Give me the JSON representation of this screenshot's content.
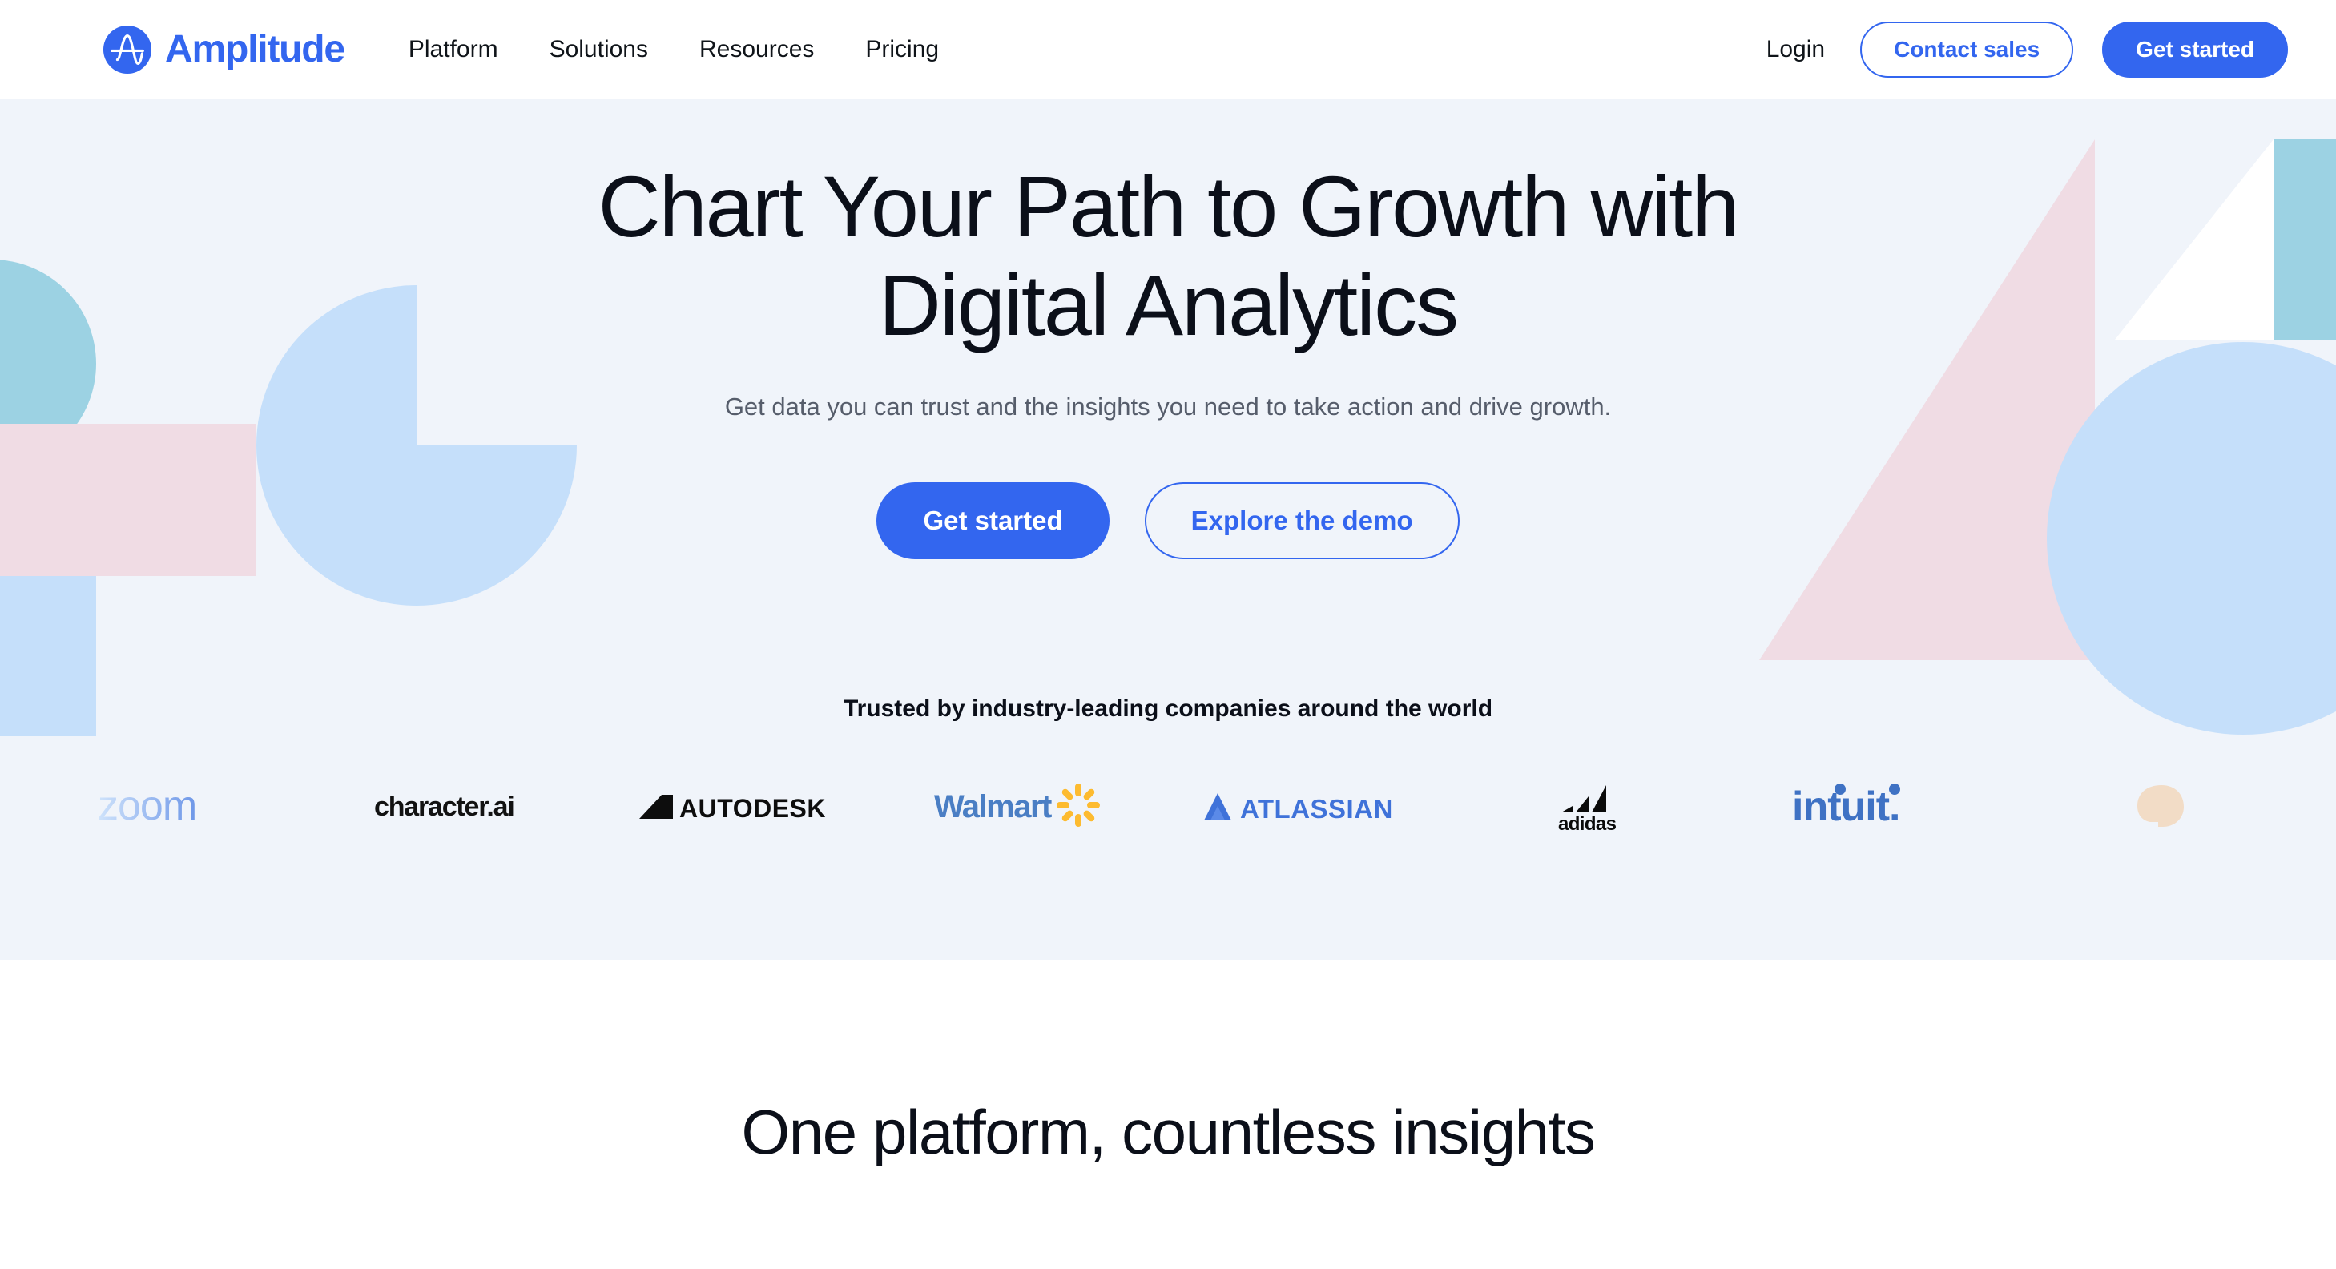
{
  "brand": {
    "name": "Amplitude",
    "logo_icon": "amplitude-wave-icon",
    "color": "#3366ef"
  },
  "nav": {
    "items": [
      {
        "label": "Platform"
      },
      {
        "label": "Solutions"
      },
      {
        "label": "Resources"
      },
      {
        "label": "Pricing"
      }
    ],
    "login_label": "Login",
    "contact_sales_label": "Contact sales",
    "get_started_label": "Get started"
  },
  "hero": {
    "title_line1": "Chart Your Path to Growth with",
    "title_line2": "Digital Analytics",
    "subtitle": "Get data you can trust and the insights you need to take action and drive growth.",
    "primary_cta": "Get started",
    "secondary_cta": "Explore the demo",
    "background_color": "#f0f4fa",
    "shape_colors": {
      "teal": "#9cd2e3",
      "pink": "#f0dce4",
      "light_blue": "#c5dffa",
      "white": "#ffffff"
    }
  },
  "social_proof": {
    "heading": "Trusted by industry-leading companies around the world",
    "logos": [
      {
        "name": "Zoom",
        "icon": "zoom-logo"
      },
      {
        "name": "character.ai",
        "icon": "character-ai-logo"
      },
      {
        "name": "AUTODESK",
        "icon": "autodesk-logo"
      },
      {
        "name": "Walmart",
        "icon": "walmart-logo"
      },
      {
        "name": "ATLASSIAN",
        "icon": "atlassian-logo"
      },
      {
        "name": "adidas",
        "icon": "adidas-logo"
      },
      {
        "name": "intuit",
        "icon": "intuit-logo"
      },
      {
        "name": "partial-logo",
        "icon": "brand-head-logo"
      }
    ]
  },
  "section_two": {
    "title": "One platform, countless insights"
  }
}
